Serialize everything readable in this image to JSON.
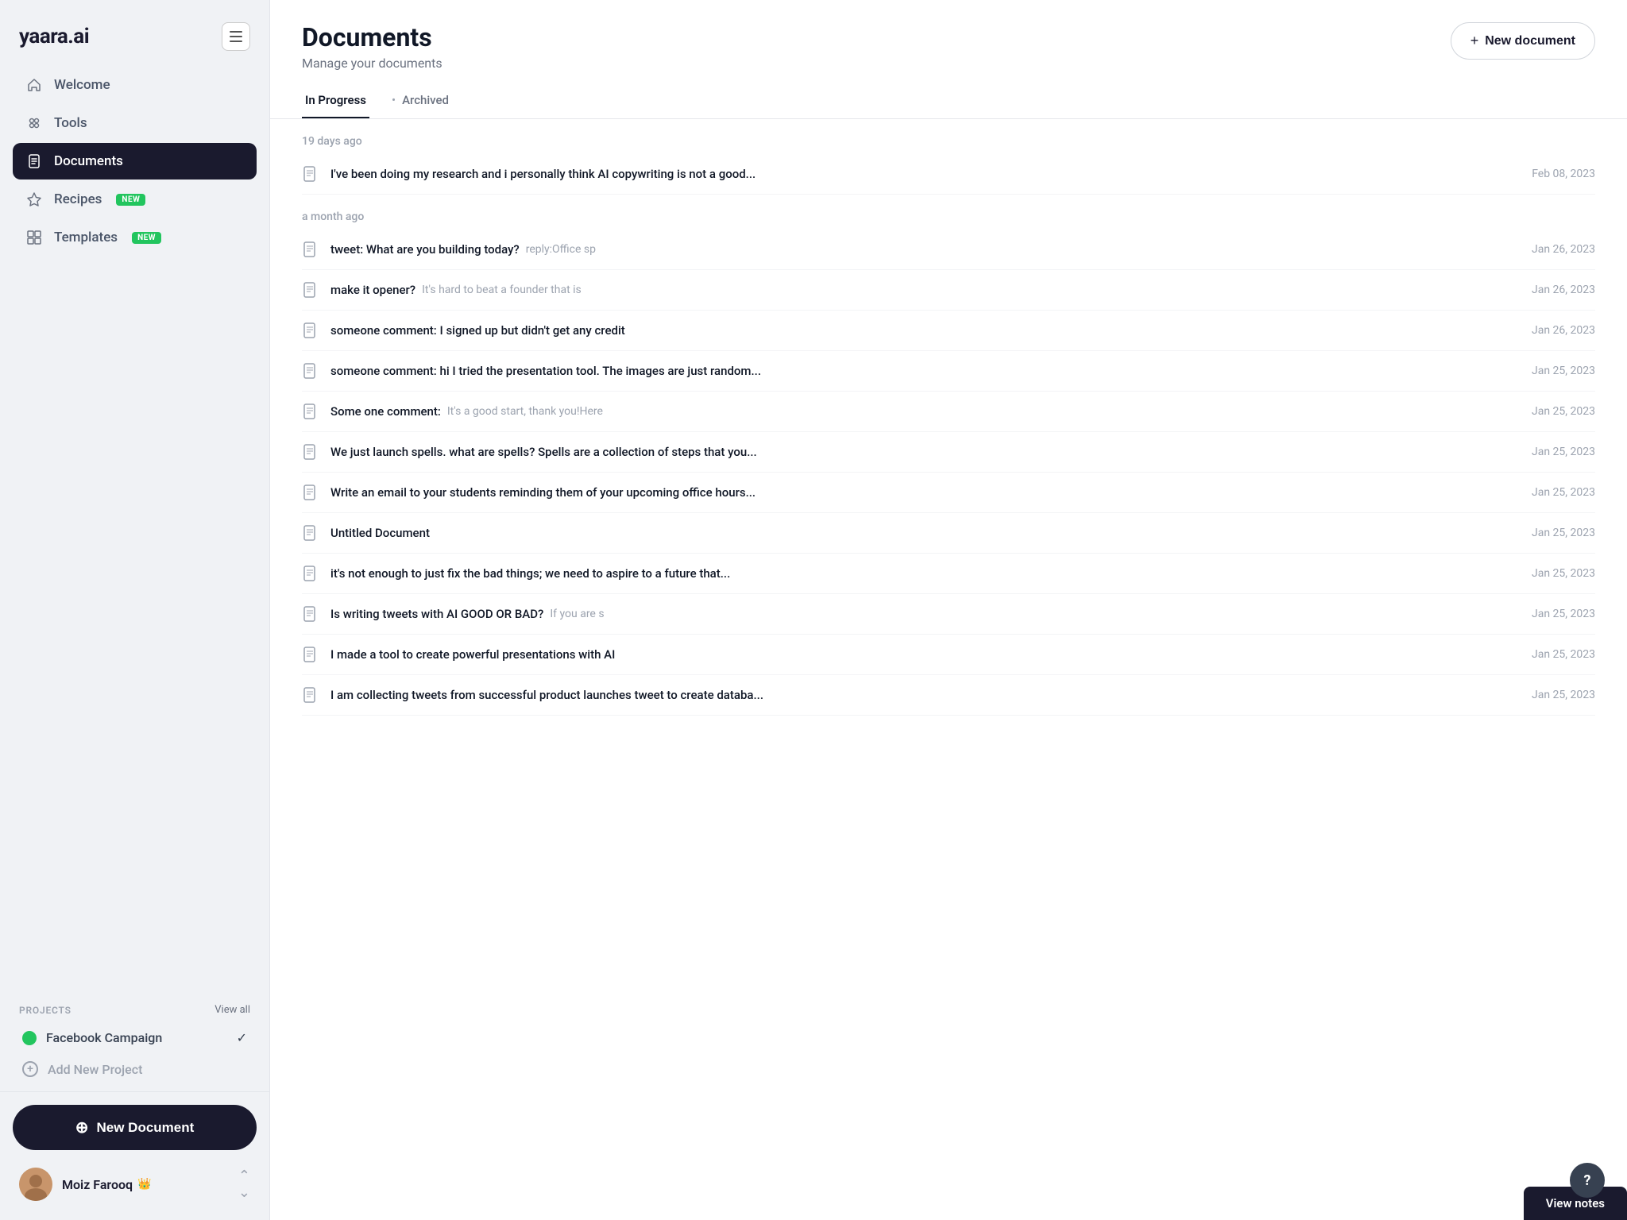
{
  "app": {
    "name": "yaara.ai"
  },
  "sidebar": {
    "toggle_label": "toggle sidebar",
    "nav_items": [
      {
        "id": "welcome",
        "label": "Welcome",
        "icon": "home"
      },
      {
        "id": "tools",
        "label": "Tools",
        "icon": "tools"
      },
      {
        "id": "documents",
        "label": "Documents",
        "icon": "documents",
        "active": true
      },
      {
        "id": "recipes",
        "label": "Recipes",
        "icon": "recipes",
        "badge": "NEW"
      },
      {
        "id": "templates",
        "label": "Templates",
        "icon": "templates",
        "badge": "NEW"
      }
    ],
    "projects_label": "PROJECTS",
    "view_all_label": "View all",
    "projects": [
      {
        "id": "facebook-campaign",
        "label": "Facebook Campaign",
        "color": "#22c55e",
        "active": true
      }
    ],
    "add_project_label": "Add New Project",
    "new_document_label": "New Document",
    "user": {
      "name": "Moiz Farooq",
      "crown": "👑"
    }
  },
  "main": {
    "page_title": "Documents",
    "page_subtitle": "Manage your documents",
    "new_document_btn": "New document",
    "tabs": [
      {
        "id": "in-progress",
        "label": "In Progress",
        "active": true
      },
      {
        "id": "archived",
        "label": "Archived",
        "active": false
      }
    ],
    "tab_separator": "•",
    "time_groups": [
      {
        "label": "19 days ago",
        "docs": [
          {
            "title": "I've been doing my research and i personally think AI copywriting is not a good...",
            "subtitle": "",
            "date": "Feb 08, 2023"
          }
        ]
      },
      {
        "label": "a month ago",
        "docs": [
          {
            "title": "tweet: What are you building today?",
            "subtitle": "reply:Office sp",
            "date": "Jan 26, 2023"
          },
          {
            "title": "make it opener?",
            "subtitle": "It's hard to beat a founder that is",
            "date": "Jan 26, 2023"
          },
          {
            "title": "someone comment: I signed up but didn't get any credit",
            "subtitle": "",
            "date": "Jan 26, 2023"
          },
          {
            "title": "someone comment: hi I tried the presentation tool. The images are just random...",
            "subtitle": "",
            "date": "Jan 25, 2023"
          },
          {
            "title": "Some one comment:",
            "subtitle": "It's a good start, thank you!Here",
            "date": "Jan 25, 2023"
          },
          {
            "title": "We just launch spells. what are spells? Spells are a collection of steps that you...",
            "subtitle": "",
            "date": "Jan 25, 2023"
          },
          {
            "title": "Write an email to your students reminding them of your upcoming office hours...",
            "subtitle": "",
            "date": "Jan 25, 2023"
          },
          {
            "title": "Untitled Document",
            "subtitle": "",
            "date": "Jan 25, 2023"
          },
          {
            "title": "it's not enough to just fix the bad things; we need to aspire to a future that...",
            "subtitle": "",
            "date": "Jan 25, 2023"
          },
          {
            "title": "Is writing tweets with AI GOOD OR BAD?",
            "subtitle": "If you are s",
            "date": "Jan 25, 2023"
          },
          {
            "title": "I made a tool to create powerful presentations with AI",
            "subtitle": "",
            "date": "Jan 25, 2023"
          },
          {
            "title": "I am collecting tweets from successful product launches tweet to create databa...",
            "subtitle": "",
            "date": "Jan 25, 2023"
          }
        ]
      }
    ],
    "help_label": "?",
    "view_notes_label": "View notes"
  }
}
